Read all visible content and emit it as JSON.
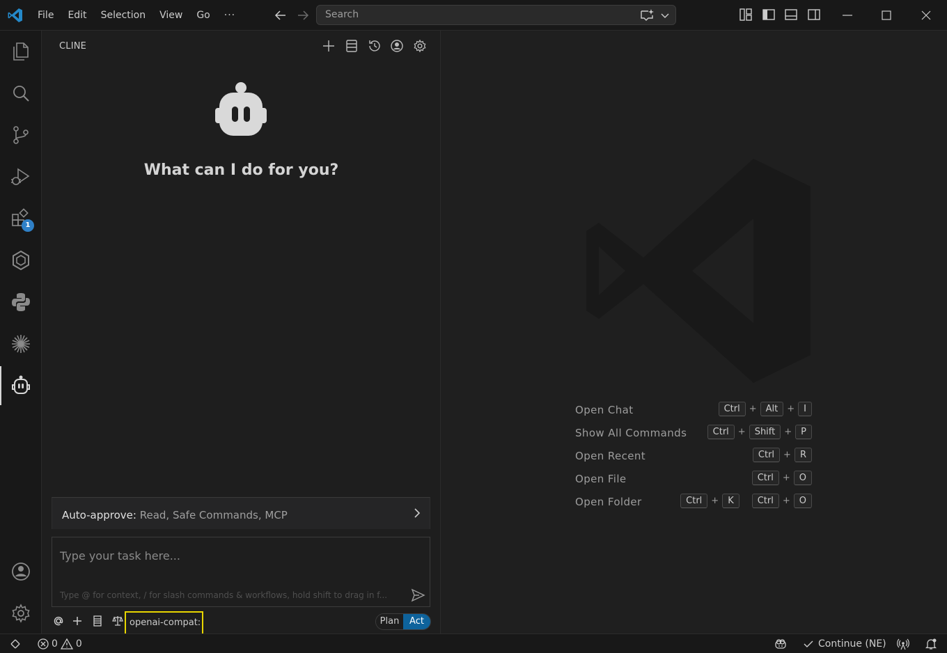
{
  "menu": {
    "items": [
      "File",
      "Edit",
      "Selection",
      "View",
      "Go"
    ],
    "more": "···"
  },
  "search": {
    "placeholder": "Search"
  },
  "sidebar": {
    "title": "CLINE",
    "extensions_badge": "1"
  },
  "cline": {
    "headline": "What can I do for you?",
    "auto_approve_label": "Auto-approve:",
    "auto_approve_value": "Read, Safe Commands, MCP",
    "task_placeholder": "Type your task here...",
    "task_hint": "Type @ for context, / for slash commands & workflows, hold shift to drag in f...",
    "model": "openai-compat:",
    "mode_plan": "Plan",
    "mode_act": "Act",
    "active_mode": "Act"
  },
  "shortcuts": [
    {
      "label": "Open Chat",
      "groups": [
        [
          "Ctrl",
          "Alt",
          "I"
        ]
      ]
    },
    {
      "label": "Show All Commands",
      "groups": [
        [
          "Ctrl",
          "Shift",
          "P"
        ]
      ]
    },
    {
      "label": "Open Recent",
      "groups": [
        [
          "Ctrl",
          "R"
        ]
      ]
    },
    {
      "label": "Open File",
      "groups": [
        [
          "Ctrl",
          "O"
        ]
      ]
    },
    {
      "label": "Open Folder",
      "groups": [
        [
          "Ctrl",
          "K"
        ],
        [
          "Ctrl",
          "O"
        ]
      ]
    }
  ],
  "status": {
    "errors": "0",
    "warnings": "0",
    "continue": "Continue (NE)"
  },
  "colors": {
    "accent": "#0e639c",
    "badge": "#2f80c7",
    "highlight": "#e8d600",
    "vscode_blue": "#2489ca"
  }
}
